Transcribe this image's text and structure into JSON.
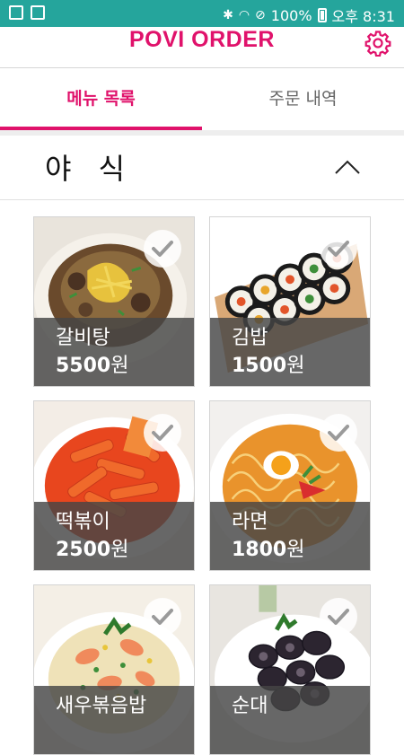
{
  "status_bar": {
    "battery": "100%",
    "time": "오후 8:31"
  },
  "app": {
    "title": "POVI ORDER"
  },
  "tabs": [
    {
      "label": "메뉴 목록",
      "active": true
    },
    {
      "label": "주문 내역",
      "active": false
    }
  ],
  "section": {
    "title": "야 식"
  },
  "menu_items": [
    {
      "name": "갈비탕",
      "price": "5500",
      "unit": "원",
      "selected": true
    },
    {
      "name": "김밥",
      "price": "1500",
      "unit": "원",
      "selected": true
    },
    {
      "name": "떡볶이",
      "price": "2500",
      "unit": "원",
      "selected": true
    },
    {
      "name": "라면",
      "price": "1800",
      "unit": "원",
      "selected": true
    },
    {
      "name": "새우볶음밥",
      "price": "",
      "unit": "",
      "selected": true
    },
    {
      "name": "순대",
      "price": "",
      "unit": "",
      "selected": true
    }
  ],
  "colors": {
    "status_bar": "#25a59c",
    "accent": "#e0126b"
  }
}
